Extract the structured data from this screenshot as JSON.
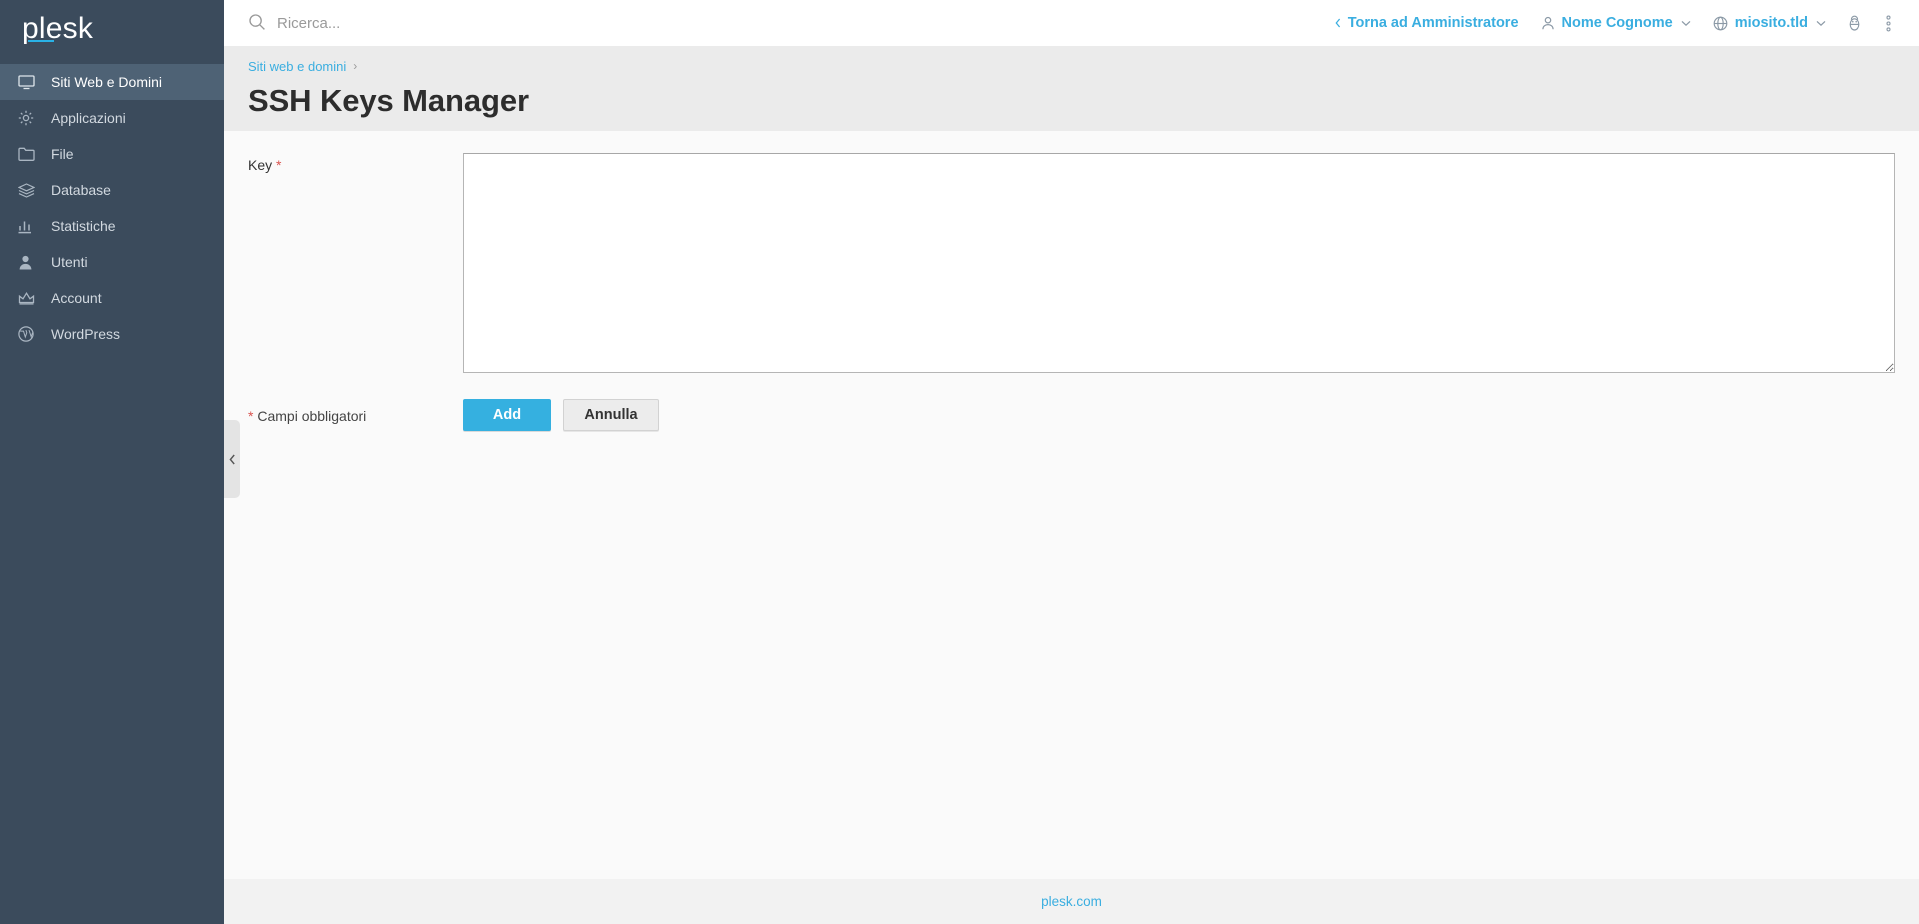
{
  "brand": {
    "name": "plesk"
  },
  "sidebar": {
    "items": [
      {
        "label": "Siti Web e Domini",
        "icon": "monitor-icon",
        "active": true
      },
      {
        "label": "Applicazioni",
        "icon": "gear-icon",
        "active": false
      },
      {
        "label": "File",
        "icon": "folder-icon",
        "active": false
      },
      {
        "label": "Database",
        "icon": "database-icon",
        "active": false
      },
      {
        "label": "Statistiche",
        "icon": "bar-chart-icon",
        "active": false
      },
      {
        "label": "Utenti",
        "icon": "user-icon",
        "active": false
      },
      {
        "label": "Account",
        "icon": "crown-icon",
        "active": false
      },
      {
        "label": "WordPress",
        "icon": "wordpress-icon",
        "active": false
      }
    ],
    "collapse_icon": "chevron-left-icon"
  },
  "topbar": {
    "search": {
      "icon": "search-icon",
      "placeholder": "Ricerca...",
      "value": ""
    },
    "back_to_admin": {
      "label": "Torna ad Amministratore",
      "icon": "chevron-left-icon"
    },
    "user_menu": {
      "label": "Nome Cognome",
      "icon": "user-icon",
      "caret": "chevron-down-icon"
    },
    "site_menu": {
      "label": "miosito.tld",
      "icon": "globe-icon",
      "caret": "chevron-down-icon"
    },
    "help_icon": "bug-icon",
    "more_icon": "more-vertical-icon"
  },
  "page": {
    "breadcrumb": {
      "parent": "Siti web e domini",
      "separator": "›"
    },
    "title": "SSH Keys Manager"
  },
  "form": {
    "key_field": {
      "label": "Key",
      "required_marker": "*",
      "value": "",
      "placeholder": ""
    },
    "required_note": {
      "marker": "*",
      "text": "Campi obbligatori"
    },
    "submit_button": "Add",
    "cancel_button": "Annulla"
  },
  "footer": {
    "link": "plesk.com"
  },
  "colors": {
    "sidebar_bg": "#3b4b5c",
    "sidebar_active": "#4e6275",
    "accent": "#35b0e0",
    "link": "#3aaee0",
    "required": "#d9534f",
    "page_head_bg": "#ebebeb",
    "panel_bg": "#fafafa"
  }
}
